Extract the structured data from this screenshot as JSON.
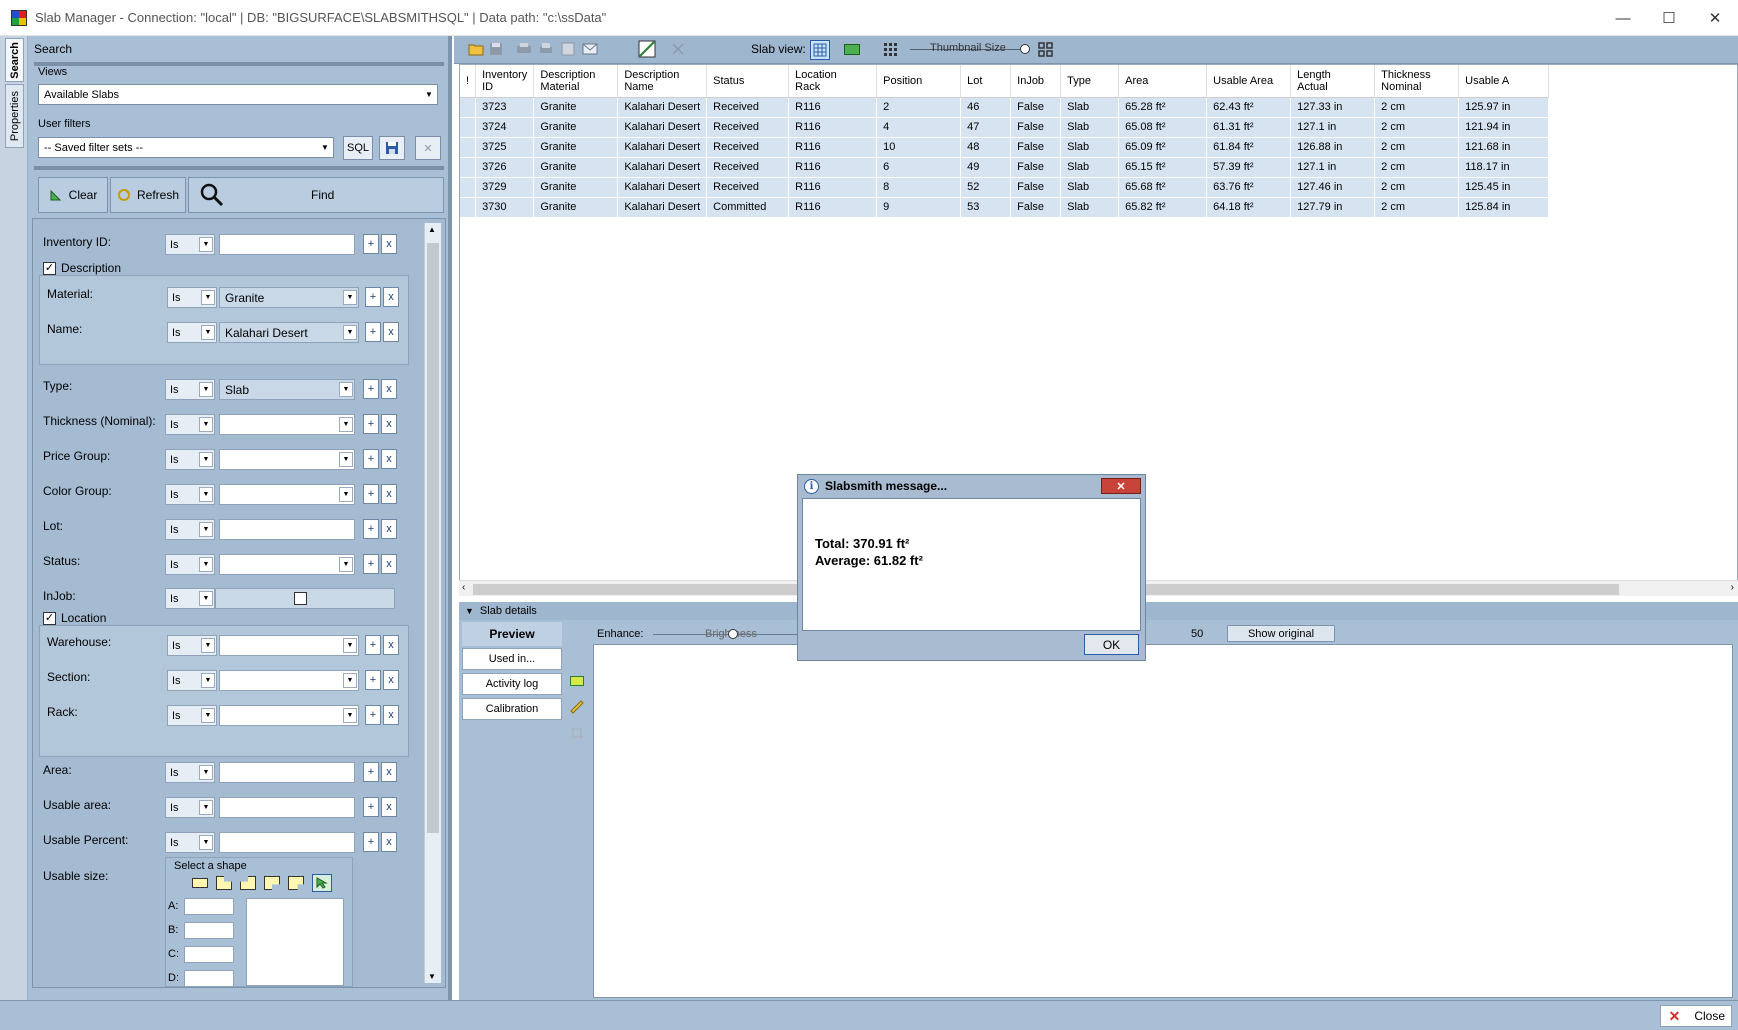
{
  "window": {
    "title": "Slab Manager -  Connection: \"local\"  |  DB: \"BIGSURFACE\\SLABSMITHSQL\"  |  Data path: \"c:\\ssData\"",
    "minimize": "—",
    "maximize": "☐",
    "close": "✕"
  },
  "vtabs": {
    "search": "Search",
    "properties": "Properties"
  },
  "left": {
    "search_title": "Search",
    "views_label": "Views",
    "views_value": "Available Slabs",
    "user_filters_label": "User filters",
    "saved_filter_sets": "-- Saved filter sets --",
    "sql_label": "SQL",
    "clear_label": "Clear",
    "refresh_label": "Refresh",
    "find_label": "Find"
  },
  "filters": {
    "inventory_id": "Inventory ID:",
    "description": "Description",
    "material": "Material:",
    "material_value": "Granite",
    "name": "Name:",
    "name_value": "Kalahari Desert",
    "type": "Type:",
    "type_value": "Slab",
    "thickness": "Thickness (Nominal):",
    "price_group": "Price Group:",
    "color_group": "Color Group:",
    "lot": "Lot:",
    "status": "Status:",
    "injob": "InJob:",
    "location": "Location",
    "warehouse": "Warehouse:",
    "section": "Section:",
    "rack": "Rack:",
    "area": "Area:",
    "usable_area": "Usable area:",
    "usable_percent": "Usable Percent:",
    "usable_size": "Usable size:",
    "select_shape": "Select a shape",
    "is": "Is",
    "plus": "+",
    "x": "x",
    "shape_a": "A:",
    "shape_b": "B:",
    "shape_c": "C:",
    "shape_d": "D:"
  },
  "toolbar": {
    "slab_view": "Slab view:",
    "thumbnail_size": "Thumbnail Size"
  },
  "grid": {
    "headers": [
      [
        "!",
        ""
      ],
      [
        "Inventory",
        "ID"
      ],
      [
        "Description",
        "Material"
      ],
      [
        "Description",
        "Name"
      ],
      [
        "Status",
        ""
      ],
      [
        "Location",
        "Rack"
      ],
      [
        "Position",
        ""
      ],
      [
        "Lot",
        ""
      ],
      [
        "InJob",
        ""
      ],
      [
        "Type",
        ""
      ],
      [
        "Area",
        ""
      ],
      [
        "Usable Area",
        ""
      ],
      [
        "Length",
        "Actual"
      ],
      [
        "Thickness",
        "Nominal"
      ],
      [
        "Usable A",
        ""
      ]
    ],
    "rows": [
      [
        "",
        "3723",
        "Granite",
        "Kalahari Desert",
        "Received",
        "R116",
        "2",
        "46",
        "False",
        "Slab",
        "65.28 ft²",
        "62.43 ft²",
        "127.33 in",
        "2 cm",
        "125.97 in"
      ],
      [
        "",
        "3724",
        "Granite",
        "Kalahari Desert",
        "Received",
        "R116",
        "4",
        "47",
        "False",
        "Slab",
        "65.08 ft²",
        "61.31 ft²",
        "127.1 in",
        "2 cm",
        "121.94 in"
      ],
      [
        "",
        "3725",
        "Granite",
        "Kalahari Desert",
        "Received",
        "R116",
        "10",
        "48",
        "False",
        "Slab",
        "65.09 ft²",
        "61.84 ft²",
        "126.88 in",
        "2 cm",
        "121.68 in"
      ],
      [
        "",
        "3726",
        "Granite",
        "Kalahari Desert",
        "Received",
        "R116",
        "6",
        "49",
        "False",
        "Slab",
        "65.15 ft²",
        "57.39 ft²",
        "127.1 in",
        "2 cm",
        "118.17 in"
      ],
      [
        "",
        "3729",
        "Granite",
        "Kalahari Desert",
        "Received",
        "R116",
        "8",
        "52",
        "False",
        "Slab",
        "65.68 ft²",
        "63.76 ft²",
        "127.46 in",
        "2 cm",
        "125.45 in"
      ],
      [
        "",
        "3730",
        "Granite",
        "Kalahari Desert",
        "Committed",
        "R116",
        "9",
        "53",
        "False",
        "Slab",
        "65.82 ft²",
        "64.18 ft²",
        "127.79 in",
        "2 cm",
        "125.84 in"
      ]
    ]
  },
  "details": {
    "header": "Slab details",
    "preview": "Preview",
    "used_in": "Used in...",
    "activity_log": "Activity log",
    "calibration": "Calibration",
    "enhance": "Enhance:",
    "brightness": "Brightness",
    "value": "50",
    "show_original": "Show original"
  },
  "dialog": {
    "title": "Slabsmith message...",
    "total": "Total: 370.91 ft²",
    "average": "Average: 61.82 ft²",
    "ok": "OK",
    "close": "✕"
  },
  "statusbar": {
    "close_label": "Close"
  }
}
